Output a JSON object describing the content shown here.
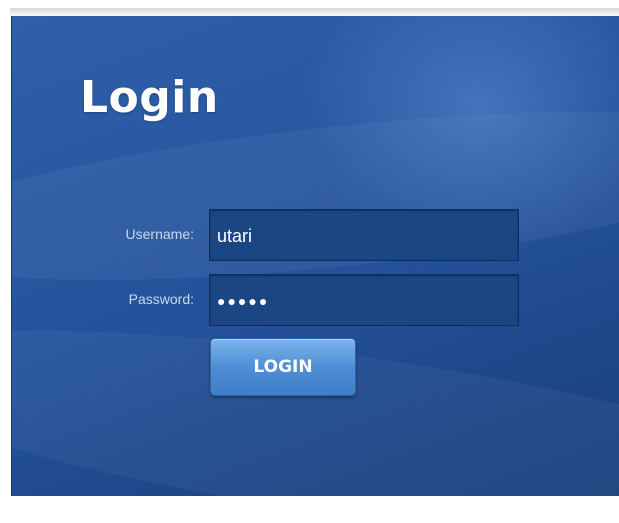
{
  "login_form": {
    "title": "Login",
    "username_label": "Username:",
    "username_value": "utari",
    "password_label": "Password:",
    "password_value": "●●●●●",
    "login_button_label": "LOGIN"
  },
  "colors": {
    "panel_background": "#2a5aa3",
    "field_background": "#1b4684",
    "button_background": "#4e8fd6",
    "label_text": "#c9d8f0"
  }
}
